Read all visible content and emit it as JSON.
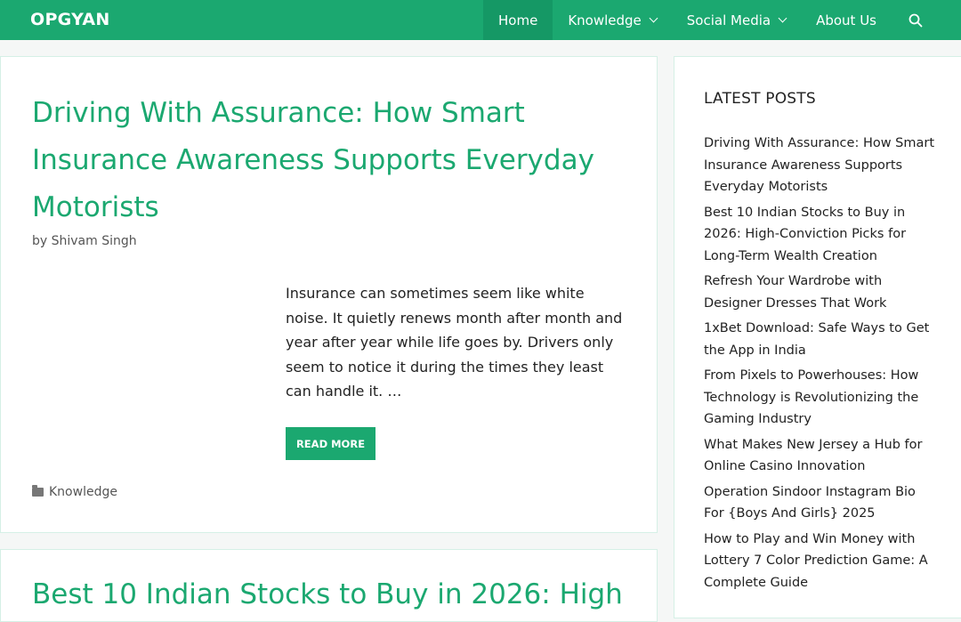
{
  "header": {
    "logo": "OPGYAN",
    "nav": [
      {
        "label": "Home",
        "active": true,
        "dropdown": false
      },
      {
        "label": "Knowledge",
        "active": false,
        "dropdown": true
      },
      {
        "label": "Social Media",
        "active": false,
        "dropdown": true
      },
      {
        "label": "About Us",
        "active": false,
        "dropdown": false
      }
    ],
    "search_icon": "search-icon"
  },
  "posts": [
    {
      "title": "Driving With Assurance: How Smart Insurance Awareness Supports Everyday Motorists",
      "byline": "by Shivam Singh",
      "excerpt": "Insurance can sometimes seem like white noise. It quietly renews month after month and year after year while life goes by. Drivers only seem to notice it during the times they least can handle it. …",
      "read_more": "READ MORE",
      "category": "Knowledge"
    },
    {
      "title": "Best 10 Indian Stocks to Buy in 2026: High"
    }
  ],
  "sidebar": {
    "title": "LATEST POSTS",
    "items": [
      "Driving With Assurance: How Smart Insurance Awareness Supports Everyday Motorists",
      "Best 10 Indian Stocks to Buy in 2026: High-Conviction Picks for Long-Term Wealth Creation",
      "Refresh Your Wardrobe with Designer Dresses That Work",
      "1xBet Download: Safe Ways to Get the App in India",
      "From Pixels to Powerhouses: How Technology is Revolutionizing the Gaming Industry",
      "What Makes New Jersey a Hub for Online Casino Innovation",
      "Operation Sindoor Instagram Bio For {Boys And Girls} 2025",
      "How to Play and Win Money with Lottery 7 Color Prediction Game: A Complete Guide"
    ]
  },
  "colors": {
    "brand": "#1ba870",
    "brand_dark": "#159865",
    "background": "#f5f7f6"
  }
}
